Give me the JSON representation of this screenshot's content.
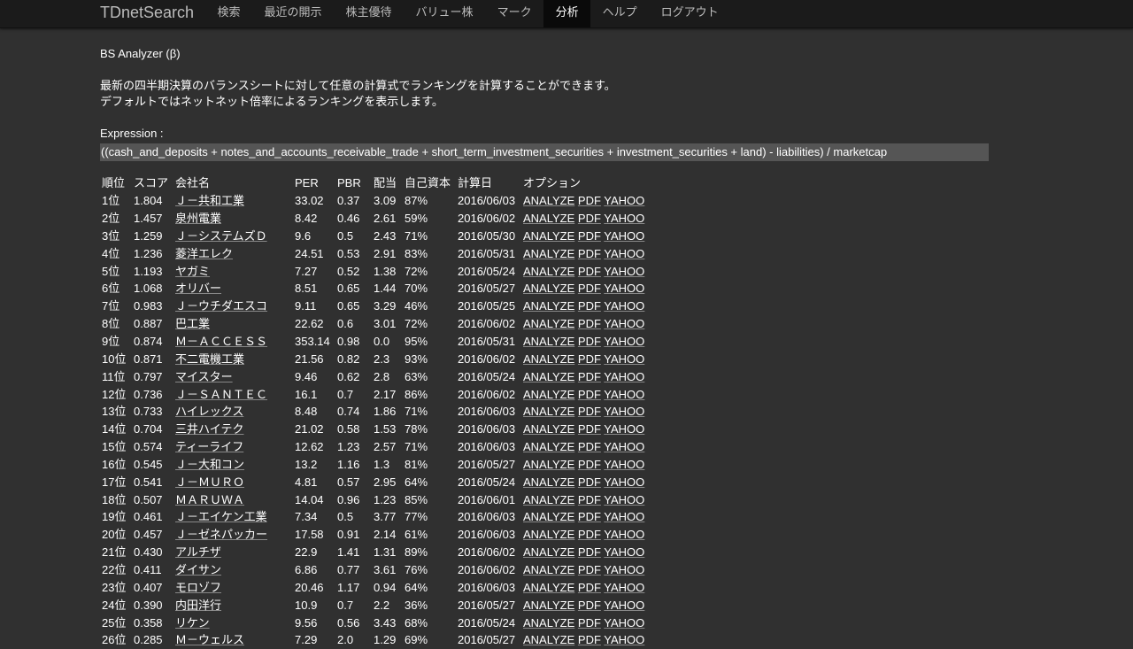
{
  "navbar": {
    "brand": "TDnetSearch",
    "items": [
      "検索",
      "最近の開示",
      "株主優待",
      "バリュー株",
      "マーク",
      "分析",
      "ヘルプ",
      "ログアウト"
    ],
    "active_index": 5
  },
  "main": {
    "title": "BS Analyzer (β)",
    "description": [
      "最新の四半期決算のバランスシートに対して任意の計算式でランキングを計算することができます。",
      "デフォルトではネットネット倍率によるランキングを表示します。"
    ],
    "expression_label": "Expression :",
    "expression": "((cash_and_deposits + notes_and_accounts_receivable_trade + short_term_investment_securities + investment_securities + land) - liabilities) / marketcap"
  },
  "table": {
    "headers": [
      "順位",
      "スコア",
      "会社名",
      "PER",
      "PBR",
      "配当",
      "自己資本",
      "計算日",
      "オプション"
    ],
    "option_links": [
      "ANALYZE",
      "PDF",
      "YAHOO"
    ],
    "rows": [
      [
        "1位",
        "1.804",
        "Ｊ－共和工業",
        "33.02",
        "0.37",
        "3.09",
        "87%",
        "2016/06/03"
      ],
      [
        "2位",
        "1.457",
        "泉州電業",
        "8.42",
        "0.46",
        "2.61",
        "59%",
        "2016/06/02"
      ],
      [
        "3位",
        "1.259",
        "Ｊ－システムズＤ",
        "9.6",
        "0.5",
        "2.43",
        "71%",
        "2016/05/30"
      ],
      [
        "4位",
        "1.236",
        "菱洋エレク",
        "24.51",
        "0.53",
        "2.91",
        "83%",
        "2016/05/31"
      ],
      [
        "5位",
        "1.193",
        "ヤガミ",
        "7.27",
        "0.52",
        "1.38",
        "72%",
        "2016/05/24"
      ],
      [
        "6位",
        "1.068",
        "オリバー",
        "8.51",
        "0.65",
        "1.44",
        "70%",
        "2016/05/27"
      ],
      [
        "7位",
        "0.983",
        "Ｊ－ウチダエスコ",
        "9.11",
        "0.65",
        "3.29",
        "46%",
        "2016/05/25"
      ],
      [
        "8位",
        "0.887",
        "巴工業",
        "22.62",
        "0.6",
        "3.01",
        "72%",
        "2016/06/02"
      ],
      [
        "9位",
        "0.874",
        "Ｍ－ＡＣＣＥＳＳ",
        "353.14",
        "0.98",
        "0.0",
        "95%",
        "2016/05/31"
      ],
      [
        "10位",
        "0.871",
        "不二電機工業",
        "21.56",
        "0.82",
        "2.3",
        "93%",
        "2016/06/02"
      ],
      [
        "11位",
        "0.797",
        "マイスター",
        "9.46",
        "0.62",
        "2.8",
        "63%",
        "2016/05/24"
      ],
      [
        "12位",
        "0.736",
        "Ｊ－ＳＡＮＴＥＣ",
        "16.1",
        "0.7",
        "2.17",
        "86%",
        "2016/06/02"
      ],
      [
        "13位",
        "0.733",
        "ハイレックス",
        "8.48",
        "0.74",
        "1.86",
        "71%",
        "2016/06/03"
      ],
      [
        "14位",
        "0.704",
        "三井ハイテク",
        "21.02",
        "0.58",
        "1.53",
        "78%",
        "2016/06/03"
      ],
      [
        "15位",
        "0.574",
        "ティーライフ",
        "12.62",
        "1.23",
        "2.57",
        "71%",
        "2016/06/03"
      ],
      [
        "16位",
        "0.545",
        "Ｊ－大和コン",
        "13.2",
        "1.16",
        "1.3",
        "81%",
        "2016/05/27"
      ],
      [
        "17位",
        "0.541",
        "Ｊ－ＭＵＲＯ",
        "4.81",
        "0.57",
        "2.95",
        "64%",
        "2016/05/24"
      ],
      [
        "18位",
        "0.507",
        "ＭＡＲＵＷＡ",
        "14.04",
        "0.96",
        "1.23",
        "85%",
        "2016/06/01"
      ],
      [
        "19位",
        "0.461",
        "Ｊ－エイケン工業",
        "7.34",
        "0.5",
        "3.77",
        "77%",
        "2016/06/03"
      ],
      [
        "20位",
        "0.457",
        "Ｊ－ゼネパッカー",
        "17.58",
        "0.91",
        "2.14",
        "61%",
        "2016/06/03"
      ],
      [
        "21位",
        "0.430",
        "アルチザ",
        "22.9",
        "1.41",
        "1.31",
        "89%",
        "2016/06/02"
      ],
      [
        "22位",
        "0.411",
        "ダイサン",
        "6.86",
        "0.77",
        "3.61",
        "76%",
        "2016/06/02"
      ],
      [
        "23位",
        "0.407",
        "モロゾフ",
        "20.46",
        "1.17",
        "0.94",
        "64%",
        "2016/06/03"
      ],
      [
        "24位",
        "0.390",
        "内田洋行",
        "10.9",
        "0.7",
        "2.2",
        "36%",
        "2016/05/27"
      ],
      [
        "25位",
        "0.358",
        "リケン",
        "9.56",
        "0.56",
        "3.43",
        "68%",
        "2016/05/24"
      ],
      [
        "26位",
        "0.285",
        "Ｍ－ウェルス",
        "7.29",
        "2.0",
        "1.29",
        "69%",
        "2016/05/27"
      ]
    ]
  }
}
